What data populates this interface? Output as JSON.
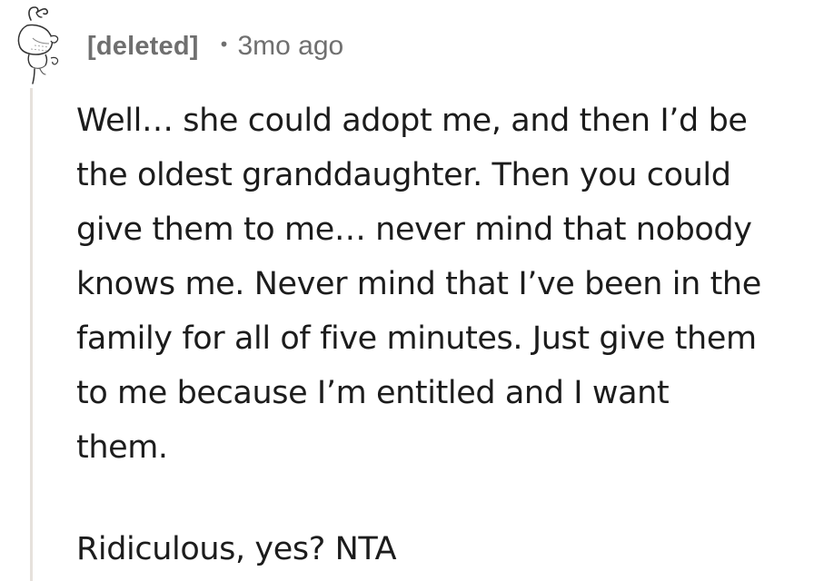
{
  "comment": {
    "author": "[deleted]",
    "separator": "•",
    "timestamp": "3mo ago",
    "body": {
      "paragraph_1_lines": [
        "Well… she could adopt me, and then I’d be",
        "the oldest granddaughter. Then you could",
        "give them to me… never mind that nobody",
        "knows me. Never mind that I’ve been in the",
        "family for all of five minutes. Just give them",
        "to me because I’m entitled and I want",
        "them."
      ],
      "paragraph_2_lines": [
        "Ridiculous, yes? NTA"
      ]
    }
  },
  "colors": {
    "meta_text": "#6f6f6f",
    "body_text": "#1c1c1c",
    "thread_line": "#e6e1dc",
    "background": "#ffffff"
  },
  "icons": {
    "avatar": "snoo-avatar-sketch"
  }
}
